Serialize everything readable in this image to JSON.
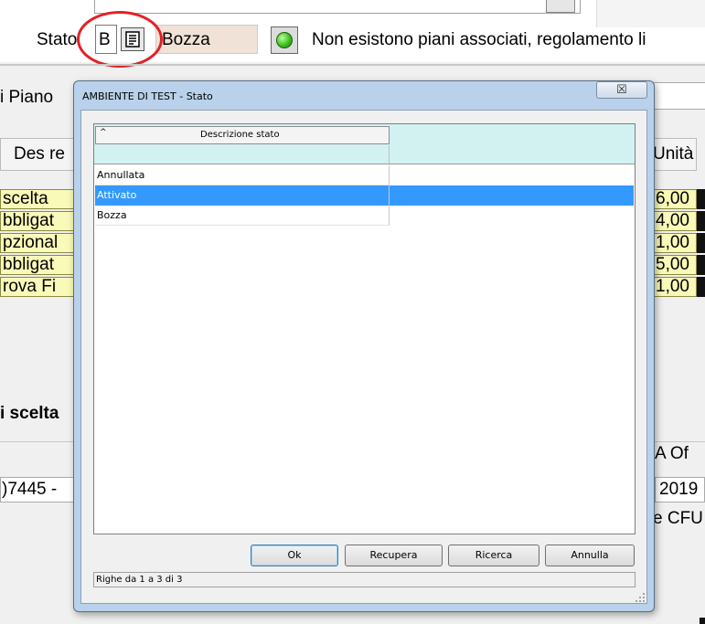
{
  "header": {
    "stato_label": "Stato",
    "stato_code": "B",
    "stato_description": "Bozza",
    "status_message": "Non esistono piani associati, regolamento li"
  },
  "piano_label": "i Piano",
  "table_background": {
    "des_header": "Des re",
    "unita_header": "Unità",
    "left_cells": [
      "scelta",
      "bbligat",
      "pzional",
      "bbligat",
      "rova Fi"
    ],
    "right_cells": [
      "6,00",
      "4,00",
      "1,00",
      "5,00",
      "1,00"
    ]
  },
  "lower": {
    "scelta_label": "i scelta",
    "aof_label": "A Of",
    "code_left": ")7445 -",
    "year_right": "2019",
    "cfu_label": "e CFU"
  },
  "dialog": {
    "title": "AMBIENTE DI TEST - Stato",
    "close_symbol": "☒",
    "column_header": "Descrizione stato",
    "sort_indicator": "^",
    "rows": [
      {
        "label": "Annullata",
        "selected": false
      },
      {
        "label": "Attivato",
        "selected": true
      },
      {
        "label": "Bozza",
        "selected": false
      }
    ],
    "buttons": {
      "ok": "Ok",
      "recupera": "Recupera",
      "ricerca": "Ricerca",
      "annulla": "Annulla"
    },
    "status_text": "Righe da 1 a 3 di 3"
  },
  "colors": {
    "selection": "#3399ff",
    "highlight_circle": "#e32025",
    "grid_header_bg": "#d2f2f2",
    "yellow_cell": "#f9f9b8"
  }
}
